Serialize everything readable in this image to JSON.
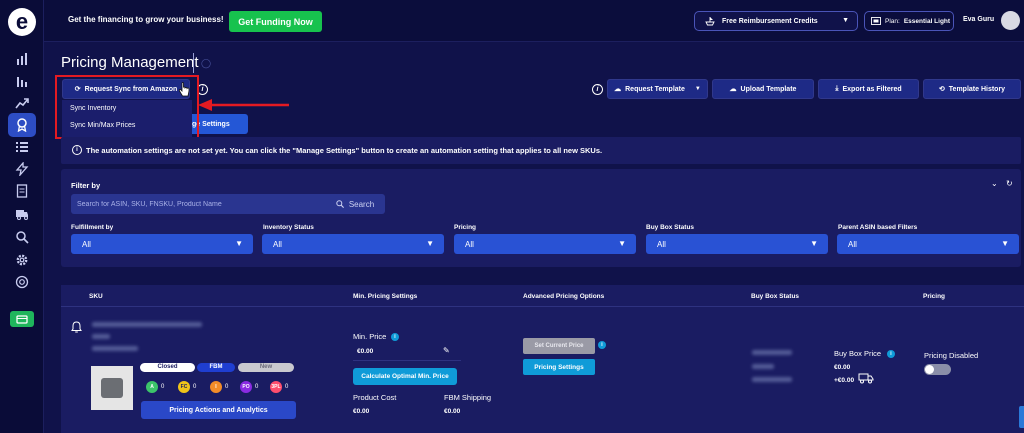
{
  "colors": {
    "background": "#10124a",
    "panel": "#1a1c62",
    "accent_blue": "#2952d4",
    "funding_green": "#17c24e",
    "highlight_red": "#e41a22",
    "cyan_button": "#0f9bd8"
  },
  "sidebar": {
    "logo": "e",
    "items": [
      {
        "icon": "bar-chart-icon"
      },
      {
        "icon": "bar-chart-alt-icon"
      },
      {
        "icon": "trend-up-icon"
      },
      {
        "icon": "award-icon",
        "active": true
      },
      {
        "icon": "list-icon"
      },
      {
        "icon": "lightning-icon"
      },
      {
        "icon": "document-icon"
      },
      {
        "icon": "truck-icon"
      },
      {
        "icon": "search-icon"
      },
      {
        "icon": "gear-icon"
      },
      {
        "icon": "support-icon"
      },
      {
        "icon": "wallet-icon"
      }
    ]
  },
  "topbar": {
    "promo_text": "Get the financing to grow your business!",
    "funding_button": "Get Funding Now",
    "credits_button": "Free Reimbursement Credits",
    "plan_prefix": "Plan:",
    "plan_name": "Essential Light",
    "user_name": "Eva Guru"
  },
  "page": {
    "title": "Pricing Management"
  },
  "toolbar": {
    "request_sync": "Request Sync from Amazon",
    "dropdown_items": [
      "Sync Inventory",
      "Sync Min/Max Prices"
    ],
    "manage_settings": "ge Settings",
    "request_template": "Request Template",
    "upload_template": "Upload Template",
    "export_filtered": "Export as Filtered",
    "template_history": "Template History"
  },
  "notice": {
    "text": "The automation settings are not set yet. You can click the \"Manage Settings\" button to create an automation setting that applies to all new SKUs."
  },
  "filters": {
    "title": "Filter by",
    "search_placeholder": "Search for ASIN, SKU, FNSKU, Product Name",
    "search_button": "Search",
    "fields": [
      {
        "label": "Fulfillment by",
        "value": "All"
      },
      {
        "label": "Inventory Status",
        "value": "All"
      },
      {
        "label": "Pricing",
        "value": "All"
      },
      {
        "label": "Buy Box Status",
        "value": "All"
      },
      {
        "label": "Parent ASIN based Filters",
        "value": "All"
      }
    ]
  },
  "table": {
    "columns": [
      "SKU",
      "Min. Pricing Settings",
      "Advanced Pricing Options",
      "Buy Box Status",
      "Pricing"
    ],
    "row": {
      "tags": [
        "Closed",
        "FBM",
        "New"
      ],
      "badges": [
        {
          "label": "A",
          "count": "0",
          "color": "#3cc46a"
        },
        {
          "label": "FC",
          "count": "0",
          "color": "#f0c419"
        },
        {
          "label": "I",
          "count": "0",
          "color": "#f28c28"
        },
        {
          "label": "PO",
          "count": "0",
          "color": "#8a2be2"
        },
        {
          "label": "3PL",
          "count": "0",
          "color": "#ff4d6d"
        }
      ],
      "actions_button": "Pricing Actions and Analytics",
      "min_price_label": "Min. Price",
      "min_price_value": "€0.00",
      "calc_button": "Calculate Optimal Min. Price",
      "product_cost_label": "Product Cost",
      "product_cost_value": "€0.00",
      "fbm_shipping_label": "FBM Shipping",
      "fbm_shipping_value": "€0.00",
      "set_current_price": "Set Current Price",
      "pricing_settings": "Pricing Settings",
      "buy_box_price_label": "Buy Box Price",
      "buy_box_price_value": "€0.00",
      "buy_box_shipping_value": "+€0.00",
      "pricing_status": "Pricing Disabled"
    }
  }
}
